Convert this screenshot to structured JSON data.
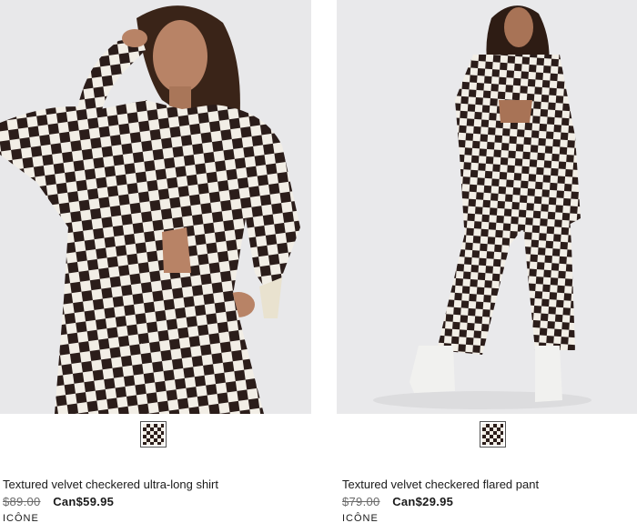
{
  "products": [
    {
      "name": "Textured velvet checkered ultra-long shirt",
      "original_price": "$89.00",
      "sale_price": "Can$59.95",
      "brand": "ICÔNE",
      "swatch_color": "black-and-white checkered"
    },
    {
      "name": "Textured velvet checkered flared pant",
      "original_price": "$79.00",
      "sale_price": "Can$29.95",
      "brand": "ICÔNE",
      "swatch_color": "black-and-white checkered"
    }
  ],
  "colors": {
    "background": "#ffffff",
    "photo_backdrop": "#e9e9eb",
    "check_dark": "#2b1d1a",
    "check_light": "#f2eee6",
    "text": "#1a1a1a",
    "muted_text": "#6a6a6a"
  }
}
